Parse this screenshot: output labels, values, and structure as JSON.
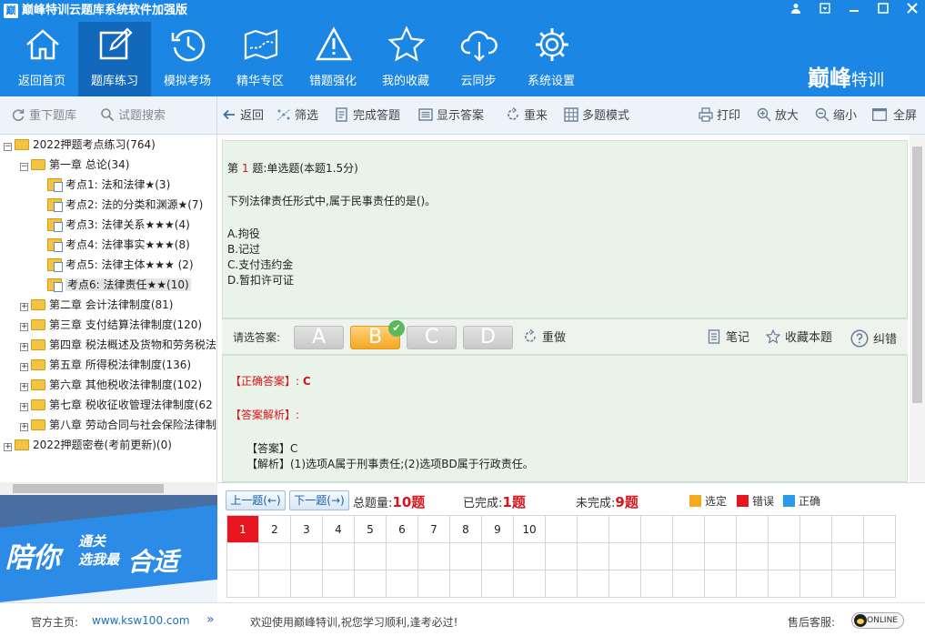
{
  "window": {
    "title": "巅峰特训云题库系统软件加强版",
    "logo_glyph": "巅",
    "controls": [
      "user-icon",
      "skin-icon",
      "minimize-icon",
      "maximize-icon",
      "close-icon"
    ]
  },
  "toolbar": {
    "items": [
      {
        "label": "返回首页",
        "icon": "home-icon"
      },
      {
        "label": "题库练习",
        "icon": "edit-icon",
        "active": true
      },
      {
        "label": "模拟考场",
        "icon": "history-icon"
      },
      {
        "label": "精华专区",
        "icon": "map-icon"
      },
      {
        "label": "错题强化",
        "icon": "warning-icon"
      },
      {
        "label": "我的收藏",
        "icon": "star-icon"
      },
      {
        "label": "云同步",
        "icon": "cloud-sync-icon"
      },
      {
        "label": "系统设置",
        "icon": "gear-icon"
      }
    ],
    "brand_main": "巅峰",
    "brand_sub": "特训"
  },
  "left_actions": {
    "reload": "重下题库",
    "search": "试题搜索"
  },
  "actions": {
    "back": "返回",
    "filter": "筛选",
    "finish": "完成答题",
    "show_answer": "显示答案",
    "redo_all": "重来",
    "multi_mode": "多题模式",
    "print": "打印",
    "zoom_in": "放大",
    "zoom_out": "缩小",
    "fullscreen": "全屏"
  },
  "tree": [
    {
      "label": "2022押题考点练习(764)",
      "level": 0,
      "expanded": true,
      "type": "folder"
    },
    {
      "label": "第一章 总论(34)",
      "level": 1,
      "expanded": true,
      "type": "folder"
    },
    {
      "label": "考点1: 法和法律★(3)",
      "level": 2,
      "type": "doc"
    },
    {
      "label": "考点2: 法的分类和渊源★(7)",
      "level": 2,
      "type": "doc"
    },
    {
      "label": "考点3: 法律关系★★★(4)",
      "level": 2,
      "type": "doc"
    },
    {
      "label": "考点4: 法律事实★★★(8)",
      "level": 2,
      "type": "doc"
    },
    {
      "label": "考点5: 法律主体★★★ (2)",
      "level": 2,
      "type": "doc"
    },
    {
      "label": "考点6: 法律责任★★(10)",
      "level": 2,
      "type": "doc",
      "selected": true
    },
    {
      "label": "第二章 会计法律制度(81)",
      "level": 1,
      "type": "folder"
    },
    {
      "label": "第三章 支付结算法律制度(120)",
      "level": 1,
      "type": "folder"
    },
    {
      "label": "第四章 税法概述及货物和劳务税法",
      "level": 1,
      "type": "folder"
    },
    {
      "label": "第五章 所得税法律制度(136)",
      "level": 1,
      "type": "folder"
    },
    {
      "label": "第六章 其他税收法律制度(102)",
      "level": 1,
      "type": "folder"
    },
    {
      "label": "第七章 税收征收管理法律制度(62",
      "level": 1,
      "type": "folder"
    },
    {
      "label": "第八章 劳动合同与社会保险法律制",
      "level": 1,
      "type": "folder"
    },
    {
      "label": "2022押题密卷(考前更新)(0)",
      "level": 0,
      "type": "folder"
    }
  ],
  "question": {
    "prefix": "第",
    "number": "1",
    "header": "题:单选题(本题1.5分)",
    "stem": "下列法律责任形式中,属于民事责任的是()。",
    "options": [
      "A.拘役",
      "B.记过",
      "C.支付违约金",
      "D.暂扣许可证"
    ]
  },
  "answer_bar": {
    "prompt": "请选答案:",
    "choices": [
      "A",
      "B",
      "C",
      "D"
    ],
    "selected": "B",
    "redo": "重做",
    "note": "笔记",
    "favorite": "收藏本题",
    "report": "纠错"
  },
  "analysis": {
    "correct_label": "【正确答案】:",
    "correct_value": "C",
    "analysis_label": "【答案解析】:",
    "answer_line": "【答案】C",
    "explain_line": "【解析】(1)选项A属于刑事责任;(2)选项BD属于行政责任。"
  },
  "nav": {
    "prev": "上一题(←)",
    "next": "下一题(→)",
    "total_label": "总题量:",
    "total_value": "10题",
    "done_label": "已完成:",
    "done_value": "1题",
    "todo_label": "未完成:",
    "todo_value": "9题",
    "legend": [
      {
        "label": "选定",
        "color": "#f7a81e"
      },
      {
        "label": "错误",
        "color": "#e5161f"
      },
      {
        "label": "正确",
        "color": "#2a9bea"
      }
    ],
    "cells": [
      "1",
      "2",
      "3",
      "4",
      "5",
      "6",
      "7",
      "8",
      "9",
      "10"
    ],
    "current": "1",
    "grid_rows": 3,
    "grid_cols": 21
  },
  "banner": {
    "t1": "陪你",
    "t2": "通关",
    "t3": "选我最",
    "t4": "合适"
  },
  "status": {
    "site_label": "官方主页:",
    "site_url": "www.ksw100.com",
    "welcome": "欢迎使用巅峰特训,祝您学习顺利,逢考必过!",
    "service_label": "售后客服:",
    "online": "ONLINE"
  }
}
